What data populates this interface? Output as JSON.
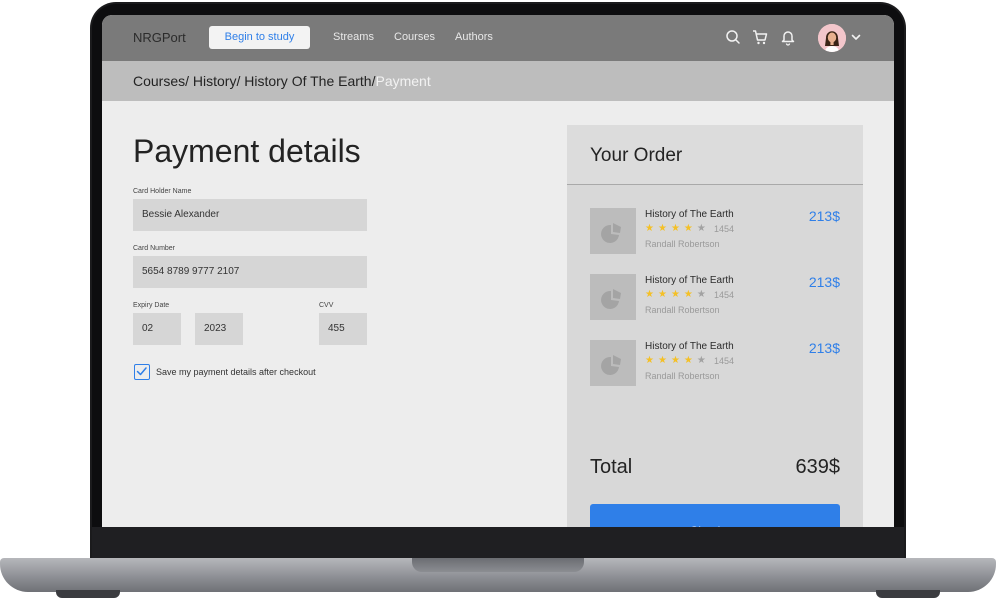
{
  "nav": {
    "logo": "NRGPort",
    "begin_label": "Begin to study",
    "links": [
      "Streams",
      "Courses",
      "Authors"
    ],
    "icons": [
      "search-icon",
      "cart-icon",
      "bell-icon",
      "chevron-down-icon"
    ]
  },
  "breadcrumb": {
    "path": "Courses/ History/ History Of The Earth/",
    "current": "Payment"
  },
  "payment": {
    "title": "Payment details",
    "holder_label": "Card Holder Name",
    "holder_value": "Bessie Alexander",
    "number_label": "Card Number",
    "number_value": "5654 8789 9777 2107",
    "expiry_label": "Expiry Date",
    "expiry_month": "02",
    "expiry_year": "2023",
    "cvv_label": "CVV",
    "cvv_value": "455",
    "save_label": "Save my payment details after checkout",
    "save_checked": true
  },
  "order": {
    "title": "Your Order",
    "items": [
      {
        "name": "History of The Earth",
        "rating": 4,
        "reviews": "1454",
        "author": "Randall Robertson",
        "price": "213$"
      },
      {
        "name": "History of The Earth",
        "rating": 4,
        "reviews": "1454",
        "author": "Randall Robertson",
        "price": "213$"
      },
      {
        "name": "History of The Earth",
        "rating": 4,
        "reviews": "1454",
        "author": "Randall Robertson",
        "price": "213$"
      }
    ],
    "total_label": "Total",
    "total_value": "639$",
    "checkout_label": "Checkout"
  },
  "colors": {
    "accent": "#2f7fe8",
    "star": "#f4c026"
  }
}
